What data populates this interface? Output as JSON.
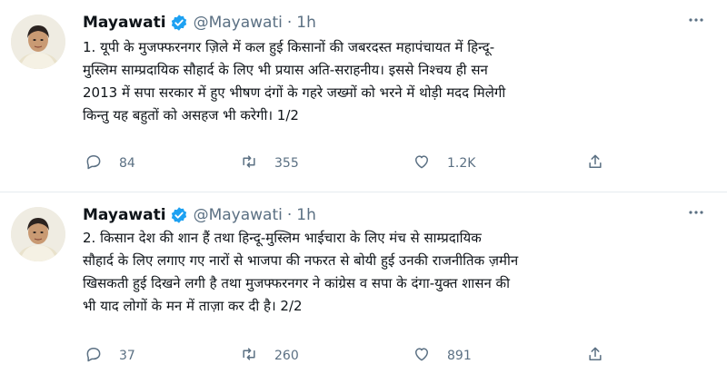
{
  "tweets": [
    {
      "name": "Mayawati",
      "handle": "@Mayawati",
      "separator": "·",
      "time": "1h",
      "text": "1. यूपी के मुजफ्फरनगर ज़िले में कल हुई किसानों की जबरदस्त महापंचायत में हिन्दू-\nमुस्लिम साम्प्रदायिक सौहार्द के लिए भी प्रयास अति-सराहनीय। इससे निश्चय ही सन\n2013 में सपा सरकार में हुए भीषण दंगों के गहरे जख्मों को भरने में थोड़ी मदद मिलेगी\nकिन्तु यह बहुतों को असहज भी करेगी। 1/2",
      "replies": "84",
      "retweets": "355",
      "likes": "1.2K"
    },
    {
      "name": "Mayawati",
      "handle": "@Mayawati",
      "separator": "·",
      "time": "1h",
      "text": "2. किसान देश की शान हैं तथा हिन्दू-मुस्लिम भाईचारा के लिए मंच से साम्प्रदायिक\nसौहार्द के लिए लगाए गए नारों से भाजपा की नफरत से बोयी हुई उनकी राजनीतिक ज़मीन\nखिसकती हुई दिखने लगी है तथा मुजफ्फरनगर ने कांग्रेस व सपा के दंगा-युक्त शासन की\nभी याद लोगों के मन में ताज़ा कर दी है। 2/2",
      "replies": "37",
      "retweets": "260",
      "likes": "891"
    }
  ],
  "icons": {
    "verified": "verified-badge-icon",
    "reply": "reply-icon",
    "retweet": "retweet-icon",
    "like": "heart-icon",
    "share": "share-icon",
    "more": "more-icon"
  },
  "colors": {
    "verified": "#1da1f2",
    "muted": "#5b7083",
    "text": "#0f1419",
    "divider": "#e6ecf0"
  }
}
